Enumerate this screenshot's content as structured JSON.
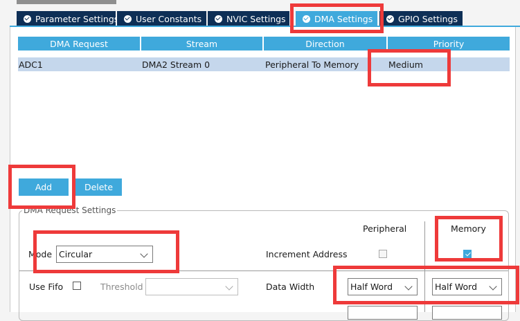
{
  "tabs": [
    {
      "label": "Parameter Settings"
    },
    {
      "label": "User Constants"
    },
    {
      "label": "NVIC Settings"
    },
    {
      "label": "DMA Settings"
    },
    {
      "label": "GPIO Settings"
    }
  ],
  "active_tab": "DMA Settings",
  "table": {
    "headers": [
      "DMA Request",
      "Stream",
      "Direction",
      "Priority"
    ],
    "rows": [
      {
        "request": "ADC1",
        "stream": "DMA2 Stream 0",
        "direction": "Peripheral To Memory",
        "priority": "Medium"
      }
    ]
  },
  "buttons": {
    "add": "Add",
    "delete": "Delete"
  },
  "settings": {
    "title": "DMA Request Settings",
    "peripheral_header": "Peripheral",
    "memory_header": "Memory",
    "mode_label": "Mode",
    "mode_value": "Circular",
    "increment_label": "Increment Address",
    "peripheral_increment": false,
    "memory_increment": true,
    "use_fifo_label": "Use Fifo",
    "use_fifo": false,
    "threshold_label": "Threshold",
    "threshold_value": "",
    "data_width_label": "Data Width",
    "peripheral_width": "Half Word",
    "memory_width": "Half Word"
  },
  "colors": {
    "tab_bg": "#0e2f56",
    "accent": "#3fa9dc",
    "highlight": "#ee3a3a"
  }
}
